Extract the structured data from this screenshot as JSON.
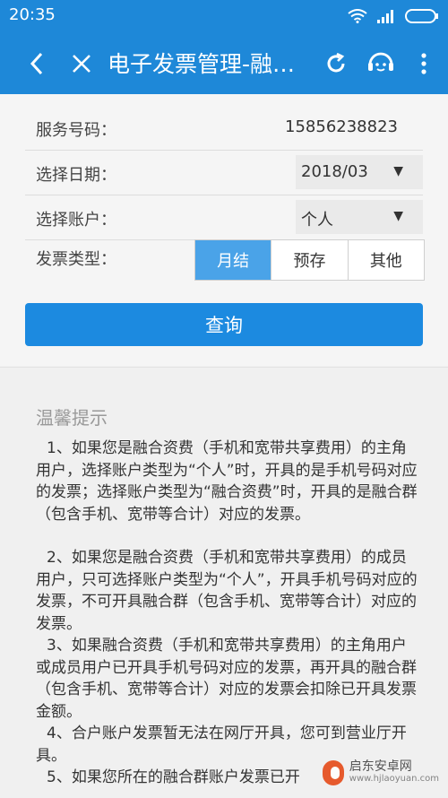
{
  "status_bar": {
    "time": "20:35"
  },
  "app_bar": {
    "title": "电子发票管理-融…"
  },
  "form": {
    "service_number": {
      "label": "服务号码：",
      "value": "15856238823"
    },
    "date": {
      "label": "选择日期：",
      "selected": "2018/03"
    },
    "account": {
      "label": "选择账户：",
      "selected": "个人"
    },
    "invoice_type": {
      "label": "发票类型：",
      "options": [
        "月结",
        "预存",
        "其他"
      ],
      "selected_index": 0
    },
    "query_button": "查询"
  },
  "tips": {
    "heading": "温馨提示",
    "paragraphs": [
      "1、如果您是融合资费（手机和宽带共享费用）的主角用户，选择账户类型为“个人”时，开具的是手机号码对应的发票；选择账户类型为“融合资费”时，开具的是融合群（包含手机、宽带等合计）对应的发票。",
      "2、如果您是融合资费（手机和宽带共享费用）的成员用户，只可选择账户类型为“个人”，开具手机号码对应的发票，不可开具融合群（包含手机、宽带等合计）对应的发票。",
      "3、如果融合资费（手机和宽带共享费用）的主角用户或成员用户已开具手机号码对应的发票，再开具的融合群（包含手机、宽带等合计）对应的发票会扣除已开具发票金额。",
      "4、合户账户发票暂无法在网厅开具，您可到营业厅开具。",
      "5、如果您所在的融合群账户发票已开"
    ]
  },
  "watermark": {
    "brand": "启东安卓网",
    "url": "www.hjlaoyuan.com"
  }
}
